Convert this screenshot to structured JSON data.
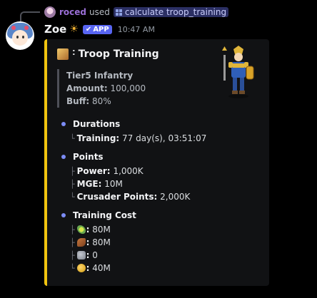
{
  "reply": {
    "username": "roced",
    "used_text": "used",
    "command": "calculate troop_training"
  },
  "message": {
    "author": "Zoe",
    "author_emoji": "☀",
    "badge": "APP",
    "badge_check": "✔",
    "timestamp": "10:47 AM"
  },
  "embed": {
    "accent_color": "#f1c40f",
    "title_prefix": "˸",
    "title": "Troop Training",
    "unit": {
      "name": "Tier5 Infantry",
      "amount_label": "Amount:",
      "amount_value": "100,000",
      "buff_label": "Buff:",
      "buff_value": "80%"
    },
    "sections": [
      {
        "title": "Durations",
        "items": [
          {
            "tree": "└",
            "label": "Training:",
            "value": "77 day(s), 03:51:07"
          }
        ]
      },
      {
        "title": "Points",
        "items": [
          {
            "tree": "├",
            "label": "Power:",
            "value": "1,000K"
          },
          {
            "tree": "├",
            "label": "MGE:",
            "value": "10M"
          },
          {
            "tree": "└",
            "label": "Crusader Points:",
            "value": "2,000K"
          }
        ]
      },
      {
        "title": "Training Cost",
        "items": [
          {
            "tree": "├",
            "icon": "corn-icon",
            "label": ":",
            "value": "80M"
          },
          {
            "tree": "├",
            "icon": "wood-icon",
            "label": ":",
            "value": "80M"
          },
          {
            "tree": "├",
            "icon": "stone-icon",
            "label": ":",
            "value": "0"
          },
          {
            "tree": "└",
            "icon": "gold-icon",
            "label": ":",
            "value": "40M"
          }
        ]
      }
    ]
  }
}
